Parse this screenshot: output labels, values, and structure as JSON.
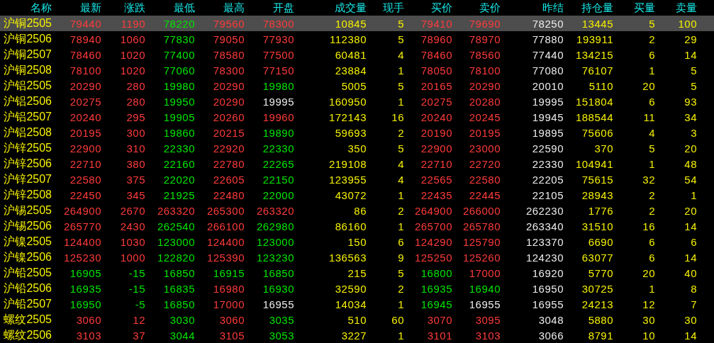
{
  "columns": [
    {
      "label": "名称",
      "kind": "name"
    },
    {
      "label": "最新",
      "kind": "price"
    },
    {
      "label": "涨跌",
      "kind": "price"
    },
    {
      "label": "最低",
      "kind": "price"
    },
    {
      "label": "最高",
      "kind": "price"
    },
    {
      "label": "开盘",
      "kind": "price"
    },
    {
      "label": "成交量",
      "kind": "volume"
    },
    {
      "label": "现手",
      "kind": "volume"
    },
    {
      "label": "买价",
      "kind": "price"
    },
    {
      "label": "卖价",
      "kind": "price"
    },
    {
      "label": "昨结",
      "kind": "plain"
    },
    {
      "label": "持仓量",
      "kind": "volume"
    },
    {
      "label": "买量",
      "kind": "volume"
    },
    {
      "label": "卖量",
      "kind": "volume"
    }
  ],
  "rows": [
    {
      "selected": true,
      "cells": [
        "沪铜2505",
        {
          "text": "79440",
          "color": "#ff3b3b"
        },
        {
          "text": "1190",
          "color": "#ff3b3b"
        },
        {
          "text": "78220",
          "color": "#00e600"
        },
        {
          "text": "79560",
          "color": "#ff3b3b"
        },
        {
          "text": "78300",
          "color": "#ff3b3b"
        },
        "10845",
        "5",
        {
          "text": "79410",
          "color": "#ff3b3b"
        },
        {
          "text": "79690",
          "color": "#ff3b3b"
        },
        "78250",
        "13445",
        "5",
        "100"
      ]
    },
    {
      "selected": false,
      "cells": [
        "沪铜2506",
        {
          "text": "78940",
          "color": "#ff3b3b"
        },
        {
          "text": "1060",
          "color": "#ff3b3b"
        },
        {
          "text": "77830",
          "color": "#00e600"
        },
        {
          "text": "79050",
          "color": "#ff3b3b"
        },
        {
          "text": "77930",
          "color": "#ff3b3b"
        },
        "112380",
        "5",
        {
          "text": "78960",
          "color": "#ff3b3b"
        },
        {
          "text": "78970",
          "color": "#ff3b3b"
        },
        "77880",
        "193911",
        "2",
        "29"
      ]
    },
    {
      "selected": false,
      "cells": [
        "沪铜2507",
        {
          "text": "78460",
          "color": "#ff3b3b"
        },
        {
          "text": "1020",
          "color": "#ff3b3b"
        },
        {
          "text": "77400",
          "color": "#00e600"
        },
        {
          "text": "78580",
          "color": "#ff3b3b"
        },
        {
          "text": "77500",
          "color": "#ff3b3b"
        },
        "60481",
        "4",
        {
          "text": "78460",
          "color": "#ff3b3b"
        },
        {
          "text": "78560",
          "color": "#ff3b3b"
        },
        "77440",
        "134215",
        "6",
        "14"
      ]
    },
    {
      "selected": false,
      "cells": [
        "沪铜2508",
        {
          "text": "78100",
          "color": "#ff3b3b"
        },
        {
          "text": "1020",
          "color": "#ff3b3b"
        },
        {
          "text": "77060",
          "color": "#00e600"
        },
        {
          "text": "78300",
          "color": "#ff3b3b"
        },
        {
          "text": "77150",
          "color": "#ff3b3b"
        },
        "23884",
        "1",
        {
          "text": "78050",
          "color": "#ff3b3b"
        },
        {
          "text": "78100",
          "color": "#ff3b3b"
        },
        "77080",
        "76107",
        "1",
        "5"
      ]
    },
    {
      "selected": false,
      "cells": [
        "沪铝2505",
        {
          "text": "20290",
          "color": "#ff3b3b"
        },
        {
          "text": "280",
          "color": "#ff3b3b"
        },
        {
          "text": "19980",
          "color": "#00e600"
        },
        {
          "text": "20290",
          "color": "#ff3b3b"
        },
        {
          "text": "19980",
          "color": "#00e600"
        },
        "5005",
        "5",
        {
          "text": "20165",
          "color": "#ff3b3b"
        },
        {
          "text": "20290",
          "color": "#ff3b3b"
        },
        "20010",
        "5110",
        "20",
        "5"
      ]
    },
    {
      "selected": false,
      "cells": [
        "沪铝2506",
        {
          "text": "20275",
          "color": "#ff3b3b"
        },
        {
          "text": "280",
          "color": "#ff3b3b"
        },
        {
          "text": "19950",
          "color": "#00e600"
        },
        {
          "text": "20290",
          "color": "#ff3b3b"
        },
        {
          "text": "19995",
          "color": "#ececec"
        },
        "160950",
        "1",
        {
          "text": "20275",
          "color": "#ff3b3b"
        },
        {
          "text": "20280",
          "color": "#ff3b3b"
        },
        "19995",
        "151804",
        "6",
        "93"
      ]
    },
    {
      "selected": false,
      "cells": [
        "沪铝2507",
        {
          "text": "20240",
          "color": "#ff3b3b"
        },
        {
          "text": "295",
          "color": "#ff3b3b"
        },
        {
          "text": "19905",
          "color": "#00e600"
        },
        {
          "text": "20260",
          "color": "#ff3b3b"
        },
        {
          "text": "19960",
          "color": "#ff3b3b"
        },
        "172143",
        "16",
        {
          "text": "20240",
          "color": "#ff3b3b"
        },
        {
          "text": "20245",
          "color": "#ff3b3b"
        },
        "19945",
        "188544",
        "11",
        "34"
      ]
    },
    {
      "selected": false,
      "cells": [
        "沪铝2508",
        {
          "text": "20195",
          "color": "#ff3b3b"
        },
        {
          "text": "300",
          "color": "#ff3b3b"
        },
        {
          "text": "19860",
          "color": "#00e600"
        },
        {
          "text": "20215",
          "color": "#ff3b3b"
        },
        {
          "text": "19890",
          "color": "#00e600"
        },
        "59693",
        "2",
        {
          "text": "20190",
          "color": "#ff3b3b"
        },
        {
          "text": "20195",
          "color": "#ff3b3b"
        },
        "19895",
        "75606",
        "4",
        "3"
      ]
    },
    {
      "selected": false,
      "cells": [
        "沪锌2505",
        {
          "text": "22900",
          "color": "#ff3b3b"
        },
        {
          "text": "310",
          "color": "#ff3b3b"
        },
        {
          "text": "22330",
          "color": "#00e600"
        },
        {
          "text": "22920",
          "color": "#ff3b3b"
        },
        {
          "text": "22330",
          "color": "#00e600"
        },
        "350",
        "5",
        {
          "text": "22900",
          "color": "#ff3b3b"
        },
        {
          "text": "23000",
          "color": "#ff3b3b"
        },
        "22590",
        "370",
        "5",
        "20"
      ]
    },
    {
      "selected": false,
      "cells": [
        "沪锌2506",
        {
          "text": "22710",
          "color": "#ff3b3b"
        },
        {
          "text": "380",
          "color": "#ff3b3b"
        },
        {
          "text": "22160",
          "color": "#00e600"
        },
        {
          "text": "22780",
          "color": "#ff3b3b"
        },
        {
          "text": "22265",
          "color": "#00e600"
        },
        "219108",
        "4",
        {
          "text": "22710",
          "color": "#ff3b3b"
        },
        {
          "text": "22720",
          "color": "#ff3b3b"
        },
        "22330",
        "104941",
        "1",
        "48"
      ]
    },
    {
      "selected": false,
      "cells": [
        "沪锌2507",
        {
          "text": "22580",
          "color": "#ff3b3b"
        },
        {
          "text": "375",
          "color": "#ff3b3b"
        },
        {
          "text": "22020",
          "color": "#00e600"
        },
        {
          "text": "22605",
          "color": "#ff3b3b"
        },
        {
          "text": "22150",
          "color": "#00e600"
        },
        "123955",
        "4",
        {
          "text": "22565",
          "color": "#ff3b3b"
        },
        {
          "text": "22580",
          "color": "#ff3b3b"
        },
        "22205",
        "75615",
        "32",
        "54"
      ]
    },
    {
      "selected": false,
      "cells": [
        "沪锌2508",
        {
          "text": "22450",
          "color": "#ff3b3b"
        },
        {
          "text": "345",
          "color": "#ff3b3b"
        },
        {
          "text": "21925",
          "color": "#00e600"
        },
        {
          "text": "22480",
          "color": "#ff3b3b"
        },
        {
          "text": "22000",
          "color": "#00e600"
        },
        "43072",
        "1",
        {
          "text": "22435",
          "color": "#ff3b3b"
        },
        {
          "text": "22445",
          "color": "#ff3b3b"
        },
        "22105",
        "28943",
        "2",
        "1"
      ]
    },
    {
      "selected": false,
      "cells": [
        "沪锡2505",
        {
          "text": "264900",
          "color": "#ff3b3b"
        },
        {
          "text": "2670",
          "color": "#ff3b3b"
        },
        {
          "text": "263320",
          "color": "#ff3b3b"
        },
        {
          "text": "265300",
          "color": "#ff3b3b"
        },
        {
          "text": "263320",
          "color": "#ff3b3b"
        },
        "86",
        "2",
        {
          "text": "264900",
          "color": "#ff3b3b"
        },
        {
          "text": "266000",
          "color": "#ff3b3b"
        },
        "262230",
        "1776",
        "2",
        "20"
      ]
    },
    {
      "selected": false,
      "cells": [
        "沪锡2506",
        {
          "text": "265770",
          "color": "#ff3b3b"
        },
        {
          "text": "2430",
          "color": "#ff3b3b"
        },
        {
          "text": "262540",
          "color": "#00e600"
        },
        {
          "text": "266100",
          "color": "#ff3b3b"
        },
        {
          "text": "262980",
          "color": "#00e600"
        },
        "86160",
        "1",
        {
          "text": "265700",
          "color": "#ff3b3b"
        },
        {
          "text": "265780",
          "color": "#ff3b3b"
        },
        "263340",
        "31510",
        "16",
        "14"
      ]
    },
    {
      "selected": false,
      "cells": [
        "沪镍2505",
        {
          "text": "124400",
          "color": "#ff3b3b"
        },
        {
          "text": "1030",
          "color": "#ff3b3b"
        },
        {
          "text": "123000",
          "color": "#00e600"
        },
        {
          "text": "124400",
          "color": "#ff3b3b"
        },
        {
          "text": "123000",
          "color": "#00e600"
        },
        "150",
        "6",
        {
          "text": "124290",
          "color": "#ff3b3b"
        },
        {
          "text": "125790",
          "color": "#ff3b3b"
        },
        "123370",
        "6690",
        "6",
        "6"
      ]
    },
    {
      "selected": false,
      "cells": [
        "沪镍2506",
        {
          "text": "125230",
          "color": "#ff3b3b"
        },
        {
          "text": "1000",
          "color": "#ff3b3b"
        },
        {
          "text": "122820",
          "color": "#00e600"
        },
        {
          "text": "125390",
          "color": "#ff3b3b"
        },
        {
          "text": "123230",
          "color": "#00e600"
        },
        "136563",
        "9",
        {
          "text": "125250",
          "color": "#ff3b3b"
        },
        {
          "text": "125260",
          "color": "#ff3b3b"
        },
        "124230",
        "63077",
        "6",
        "14"
      ]
    },
    {
      "selected": false,
      "cells": [
        "沪铅2505",
        {
          "text": "16905",
          "color": "#00e600"
        },
        {
          "text": "-15",
          "color": "#00e600"
        },
        {
          "text": "16850",
          "color": "#00e600"
        },
        {
          "text": "16915",
          "color": "#00e600"
        },
        {
          "text": "16850",
          "color": "#00e600"
        },
        "215",
        "5",
        {
          "text": "16800",
          "color": "#00e600"
        },
        {
          "text": "17000",
          "color": "#ff3b3b"
        },
        "16920",
        "5770",
        "20",
        "40"
      ]
    },
    {
      "selected": false,
      "cells": [
        "沪铅2506",
        {
          "text": "16935",
          "color": "#00e600"
        },
        {
          "text": "-15",
          "color": "#00e600"
        },
        {
          "text": "16835",
          "color": "#00e600"
        },
        {
          "text": "16980",
          "color": "#ff3b3b"
        },
        {
          "text": "16930",
          "color": "#00e600"
        },
        "32590",
        "2",
        {
          "text": "16935",
          "color": "#00e600"
        },
        {
          "text": "16940",
          "color": "#00e600"
        },
        "16950",
        "30725",
        "1",
        "8"
      ]
    },
    {
      "selected": false,
      "cells": [
        "沪铅2507",
        {
          "text": "16950",
          "color": "#00e600"
        },
        {
          "text": "-5",
          "color": "#00e600"
        },
        {
          "text": "16850",
          "color": "#00e600"
        },
        {
          "text": "17000",
          "color": "#ff3b3b"
        },
        {
          "text": "16955",
          "color": "#ececec"
        },
        "14034",
        "1",
        {
          "text": "16945",
          "color": "#00e600"
        },
        {
          "text": "16955",
          "color": "#ececec"
        },
        "16955",
        "24213",
        "12",
        "7"
      ]
    },
    {
      "selected": false,
      "cells": [
        "螺纹2505",
        {
          "text": "3060",
          "color": "#ff3b3b"
        },
        {
          "text": "12",
          "color": "#ff3b3b"
        },
        {
          "text": "3030",
          "color": "#00e600"
        },
        {
          "text": "3060",
          "color": "#ff3b3b"
        },
        {
          "text": "3035",
          "color": "#00e600"
        },
        "510",
        "60",
        {
          "text": "3070",
          "color": "#ff3b3b"
        },
        {
          "text": "3095",
          "color": "#ff3b3b"
        },
        "3048",
        "5880",
        "30",
        "30"
      ]
    },
    {
      "selected": false,
      "cells": [
        "螺纹2506",
        {
          "text": "3103",
          "color": "#ff3b3b"
        },
        {
          "text": "37",
          "color": "#ff3b3b"
        },
        {
          "text": "3044",
          "color": "#00e600"
        },
        {
          "text": "3105",
          "color": "#ff3b3b"
        },
        {
          "text": "3053",
          "color": "#00e600"
        },
        "3227",
        "1",
        {
          "text": "3101",
          "color": "#ff3b3b"
        },
        {
          "text": "3103",
          "color": "#ff3b3b"
        },
        "3066",
        "8791",
        "10",
        "14"
      ]
    }
  ]
}
